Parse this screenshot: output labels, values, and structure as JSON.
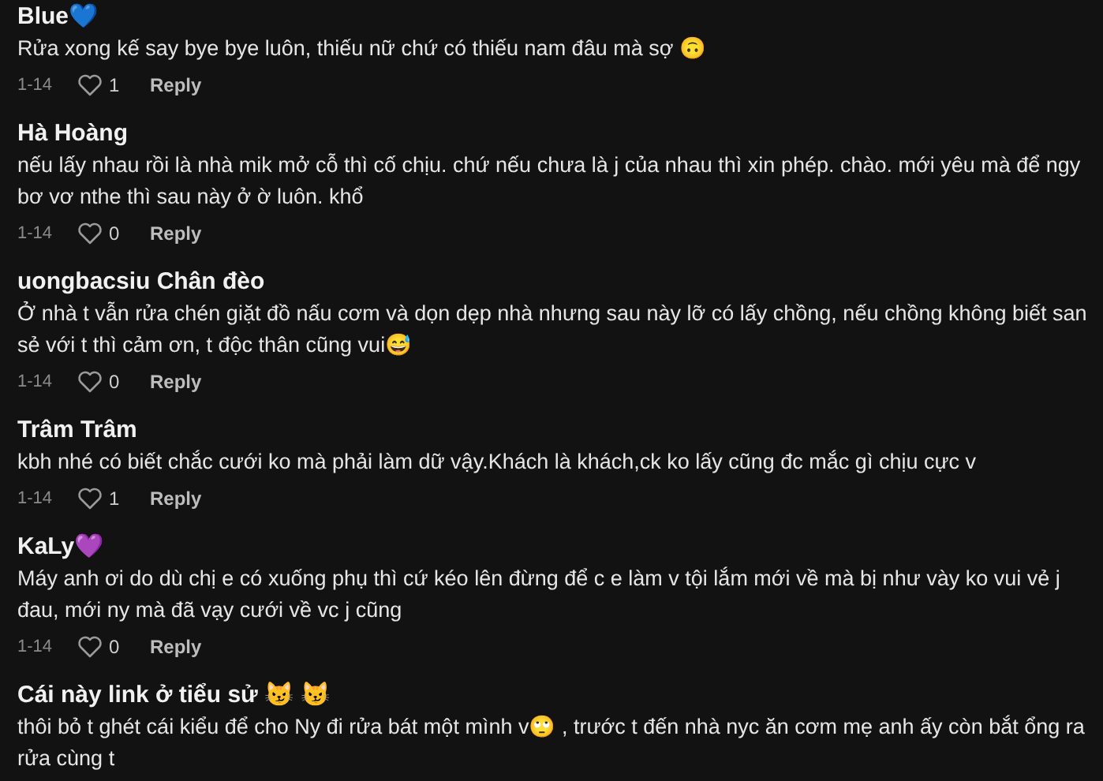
{
  "comments": [
    {
      "author": "Blue💙",
      "text": "Rửa xong kế say bye bye luôn, thiếu nữ chứ có thiếu nam đâu mà sợ 🙃",
      "date": "1-14",
      "likes": "1",
      "reply": "Reply"
    },
    {
      "author": "Hà Hoàng",
      "text": "nếu lấy nhau rồi là nhà mik mở cỗ thì cố chịu. chứ nếu chưa là j của nhau thì xin phép. chào. mới yêu mà để ngy bơ vơ nthe thì sau này ở ờ luôn. khổ",
      "date": "1-14",
      "likes": "0",
      "reply": "Reply"
    },
    {
      "author": "uongbacsiu Chân đèo",
      "text": "Ở nhà t vẫn rửa chén giặt đồ nấu cơm và dọn dẹp nhà nhưng sau này lỡ có lấy chồng, nếu chồng không biết san sẻ với t thì cảm ơn, t độc thân cũng vui😅",
      "date": "1-14",
      "likes": "0",
      "reply": "Reply"
    },
    {
      "author": "Trâm Trâm",
      "text": "kbh nhé có biết chắc cưới ko mà phải làm dữ vậy.Khách là khách,ck ko lấy cũng đc mắc gì chịu cực v",
      "date": "1-14",
      "likes": "1",
      "reply": "Reply"
    },
    {
      "author": "KaLy💜",
      "text": "Máy anh ơi do dù chị e có xuống phụ thì cứ kéo lên đừng để c e làm v tội lắm mới về mà bị như vày ko vui vẻ j đau, mới ny mà đã vạy cưới về vc j cũng",
      "date": "1-14",
      "likes": "0",
      "reply": "Reply"
    },
    {
      "author": "Cái này link ở tiểu sử 😼 😼",
      "text": "thôi bỏ t ghét cái kiểu để cho Ny đi rửa bát một mình v🙄 , trước t đến nhà nyc ăn cơm mẹ anh ấy còn bắt ổng ra rửa cùng t"
    }
  ]
}
